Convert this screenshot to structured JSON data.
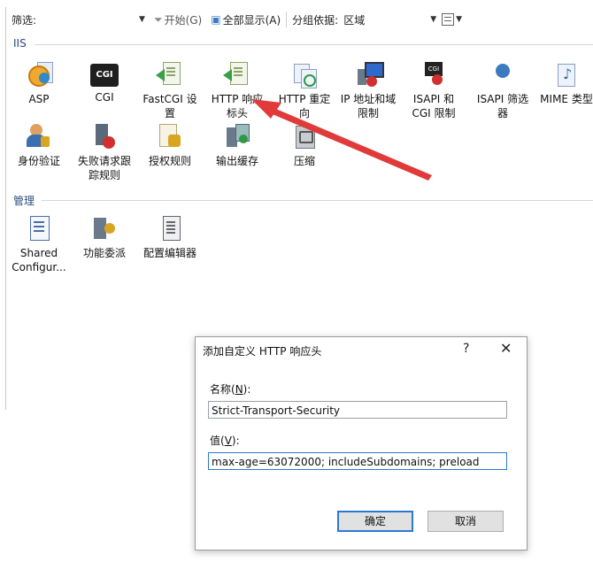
{
  "toolbar": {
    "filter_label": "筛选:",
    "start_label": "开始(G)",
    "show_all_label": "全部显示(A)",
    "group_by_label": "分组依据:",
    "group_by_value": "区域"
  },
  "sections": {
    "iis": "IIS",
    "management": "管理"
  },
  "iis_features": [
    {
      "label": "ASP",
      "icon": "asp-icon"
    },
    {
      "label": "CGI",
      "icon": "cgi-icon"
    },
    {
      "label": "FastCGI 设置",
      "icon": "fastcgi-icon"
    },
    {
      "label": "HTTP 响应标头",
      "icon": "http-response-headers-icon"
    },
    {
      "label": "HTTP 重定向",
      "icon": "http-redirect-icon"
    },
    {
      "label": "IP 地址和域限制",
      "icon": "ip-restrictions-icon"
    },
    {
      "label": "ISAPI 和 CGI 限制",
      "icon": "isapi-cgi-restrictions-icon"
    },
    {
      "label": "ISAPI 筛选器",
      "icon": "isapi-filters-icon"
    },
    {
      "label": "MIME 类型",
      "icon": "mime-types-icon"
    },
    {
      "label": "身份验证",
      "icon": "authentication-icon"
    },
    {
      "label": "失败请求跟踪规则",
      "icon": "failed-request-tracing-icon"
    },
    {
      "label": "授权规则",
      "icon": "authorization-rules-icon"
    },
    {
      "label": "输出缓存",
      "icon": "output-caching-icon"
    },
    {
      "label": "压缩",
      "icon": "compression-icon"
    }
  ],
  "mgmt_features": [
    {
      "label": "Shared Configur...",
      "icon": "shared-configuration-icon"
    },
    {
      "label": "功能委派",
      "icon": "feature-delegation-icon"
    },
    {
      "label": "配置编辑器",
      "icon": "configuration-editor-icon"
    }
  ],
  "dialog": {
    "title": "添加自定义 HTTP 响应头",
    "help": "?",
    "close": "✕",
    "name_label": "名称(",
    "name_key": "N",
    "name_label_end": "):",
    "name_value": "Strict-Transport-Security",
    "value_label": "值(",
    "value_key": "V",
    "value_label_end": "):",
    "value_value": "max-age=63072000; includeSubdomains; preload",
    "ok": "确定",
    "cancel": "取消"
  },
  "colors": {
    "arrow": "#e03a3a",
    "focus": "#2b78d4"
  }
}
